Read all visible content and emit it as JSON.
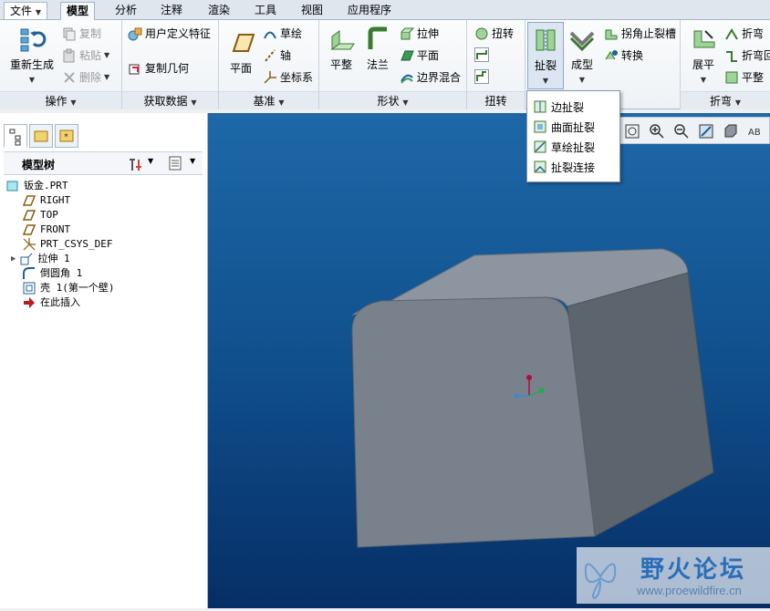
{
  "tabs": {
    "file": "文件",
    "model": "模型",
    "analysis": "分析",
    "annotate": "注释",
    "render": "渲染",
    "tools": "工具",
    "view": "视图",
    "apps": "应用程序"
  },
  "groups": {
    "operations": {
      "label": "操作",
      "regenerate": "重新生成",
      "copy": "复制",
      "paste": "粘贴",
      "delete": "删除"
    },
    "getdata": {
      "label": "获取数据",
      "udf": "用户定义特征",
      "copygeom": "复制几何"
    },
    "datum": {
      "label": "基准",
      "plane": "平面",
      "sketch": "草绘",
      "axis": "轴",
      "csys": "坐标系"
    },
    "shapes": {
      "label": "形状",
      "flat": "平整",
      "flange": "法兰",
      "extrude": "拉伸",
      "plane": "平面",
      "blend": "边界混合"
    },
    "twist": {
      "label": "扭转",
      "twist": "扭转"
    },
    "rip": {
      "rip": "扯裂",
      "form": "成型",
      "cornerrelief": "拐角止裂槽",
      "convert": "转换"
    },
    "bend": {
      "label": "折弯",
      "unbend": "展平",
      "bend": "折弯",
      "bendback": "折弯回",
      "flatten": "平整"
    }
  },
  "dropdown": {
    "items": [
      "边扯裂",
      "曲面扯裂",
      "草绘扯裂",
      "扯裂连接"
    ]
  },
  "panel": {
    "title": "模型树"
  },
  "tree": [
    "钣金.PRT",
    "RIGHT",
    "TOP",
    "FRONT",
    "PRT_CSYS_DEF",
    "拉伸 1",
    "倒圆角 1",
    "壳 1(第一个壁)",
    "在此插入"
  ],
  "watermark": {
    "title": "野火论坛",
    "url": "www.proewildfire.cn"
  }
}
